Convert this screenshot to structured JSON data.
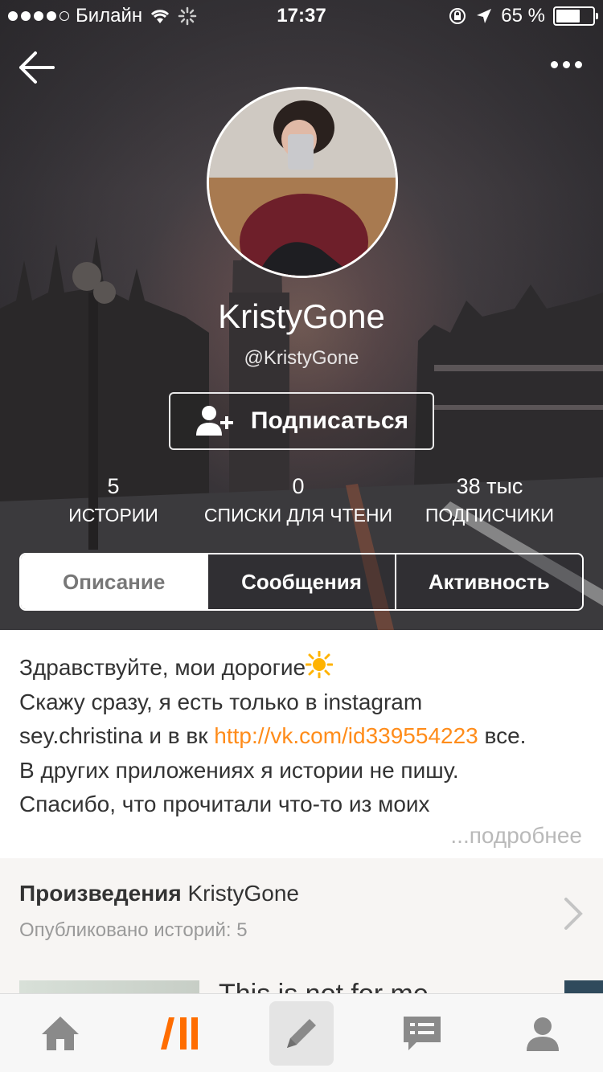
{
  "status_bar": {
    "carrier": "Билайн",
    "time": "17:37",
    "battery": "65 %",
    "battery_level": 0.65
  },
  "profile": {
    "name": "KristyGone",
    "handle": "@KristyGone",
    "follow_label": "Подписаться"
  },
  "stats": [
    {
      "value": "5",
      "label": "ИСТОРИИ"
    },
    {
      "value": "0",
      "label": "СПИСКИ ДЛЯ ЧТЕНИ"
    },
    {
      "value": "38 тыс",
      "label": "ПОДПИСЧИКИ"
    }
  ],
  "tabs": [
    {
      "label": "Описание",
      "active": true
    },
    {
      "label": "Сообщения",
      "active": false
    },
    {
      "label": "Активность",
      "active": false
    }
  ],
  "description": {
    "line1": "Здравствуйте, мои дорогие",
    "line2": "Скажу сразу, я есть только в  instagram",
    "line3_before": "sey.christina и в вк ",
    "line3_link": "http://vk.com/id339554223",
    "line3_after": " все.",
    "line4": "В других приложениях я истории не пишу.",
    "line5": "Спасибо, что прочитали что-то из моих",
    "more": "...подробнее"
  },
  "works": {
    "title_bold": "Произведения",
    "title_name": " KristyGone",
    "subtitle": "Опубликовано историй: 5",
    "first_story_title": "This is not for me..."
  },
  "tabbar": {
    "items": [
      "home-icon",
      "wattpad-logo-icon",
      "write-icon",
      "messages-icon",
      "profile-icon"
    ],
    "accent_color": "#ff6d00"
  }
}
